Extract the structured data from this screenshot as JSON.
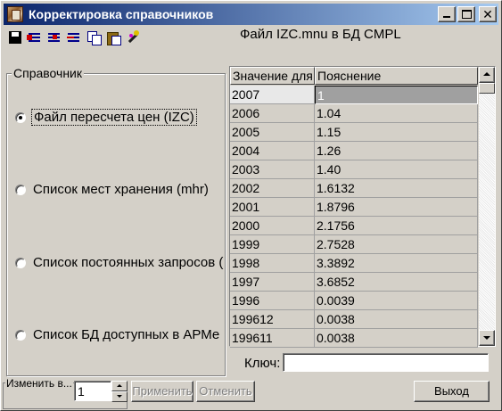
{
  "window": {
    "title": "Корректировка справочников",
    "controls": {
      "minimize": "_",
      "maximize": "□",
      "close": "✕"
    }
  },
  "toolbar": {
    "icons": [
      "save-icon",
      "insert-row-icon",
      "insert-row-after-icon",
      "delete-row-icon",
      "copy-icon",
      "paste-icon",
      "wand-icon"
    ]
  },
  "file_caption": "Файл IZC.mnu в БД CMPL",
  "reference_group": {
    "title": "Справочник",
    "options": [
      {
        "label": "Файл пересчета цен (IZC)",
        "checked": true
      },
      {
        "label": "Список мест хранения (mhr)",
        "checked": false
      },
      {
        "label": "Список постоянных запросов (i",
        "checked": false
      },
      {
        "label": "Список БД доступных в АРМе К",
        "checked": false
      }
    ]
  },
  "grid": {
    "columns": [
      "Значение для",
      "Пояснение"
    ],
    "rows": [
      {
        "key": "2007",
        "value": "1",
        "selected": true
      },
      {
        "key": "2006",
        "value": "1.04"
      },
      {
        "key": "2005",
        "value": "1.15"
      },
      {
        "key": "2004",
        "value": "1.26"
      },
      {
        "key": "2003",
        "value": "1.40"
      },
      {
        "key": "2002",
        "value": "1.6132"
      },
      {
        "key": "2001",
        "value": "1.8796"
      },
      {
        "key": "2000",
        "value": "2.1756"
      },
      {
        "key": "1999",
        "value": "2.7528"
      },
      {
        "key": "1998",
        "value": "3.3892"
      },
      {
        "key": "1997",
        "value": "3.6852"
      },
      {
        "key": "1996",
        "value": "0.0039"
      },
      {
        "key": "199612",
        "value": "0.0038"
      },
      {
        "key": "199611",
        "value": "0.0038"
      }
    ]
  },
  "key_field": {
    "label": "Ключ:",
    "value": ""
  },
  "change_group": {
    "title": "Изменить в...",
    "value": "1"
  },
  "buttons": {
    "apply": "Применить",
    "cancel": "Отменить",
    "exit": "Выход"
  }
}
